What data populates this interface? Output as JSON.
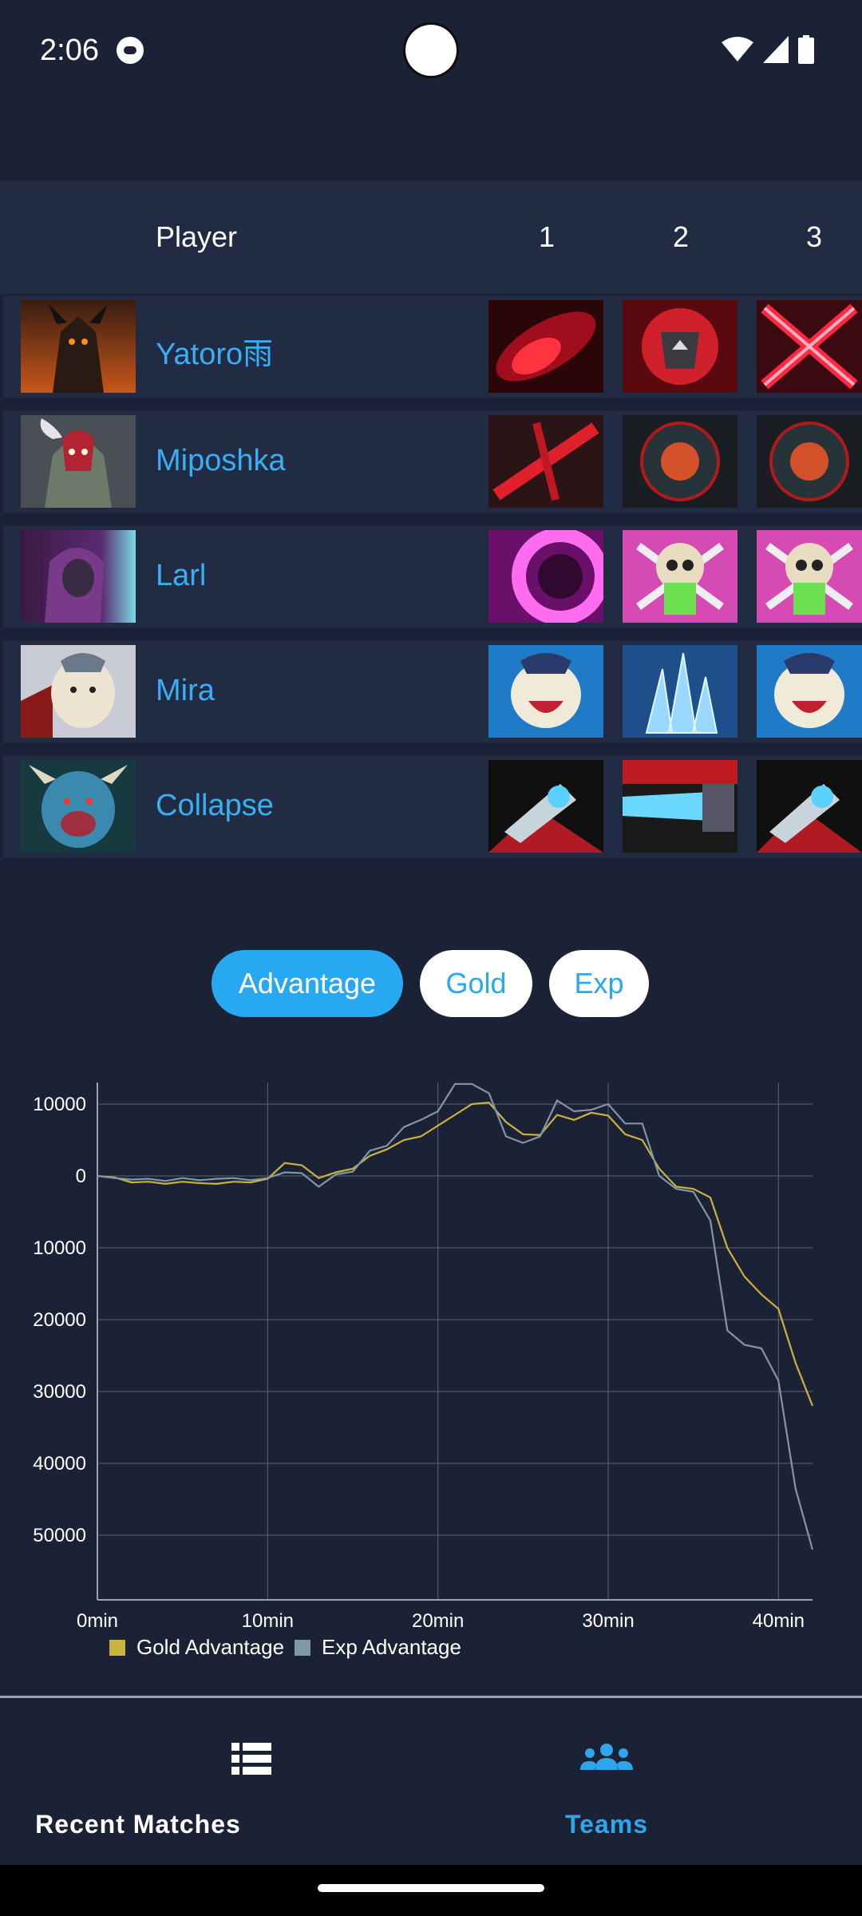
{
  "status": {
    "time": "2:06",
    "icons": [
      "app-notification-icon",
      "wifi-icon",
      "signal-icon",
      "battery-icon"
    ]
  },
  "table": {
    "headers": {
      "player": "Player",
      "col1": "1",
      "col2": "2",
      "col3": "3"
    },
    "rows": [
      {
        "name": "Yatoro雨",
        "avatar": "hero-avatar-doom",
        "items": [
          "red-slash-ability-icon",
          "red-rune-ability-icon",
          "red-x-slash-ability-icon"
        ]
      },
      {
        "name": "Miposhka",
        "avatar": "hero-avatar-shadow-demon",
        "items": [
          "red-x-slash-ability-icon",
          "blood-moon-ability-icon",
          "blood-moon-ability-icon"
        ]
      },
      {
        "name": "Larl",
        "avatar": "hero-avatar-void-spirit",
        "items": [
          "pink-swirl-ability-icon",
          "green-skull-ability-icon",
          "green-skull-ability-icon"
        ]
      },
      {
        "name": "Mira",
        "avatar": "hero-avatar-tusk",
        "items": [
          "tusk-roar-ability-icon",
          "ice-shards-ability-icon",
          "tusk-roar-ability-icon"
        ]
      },
      {
        "name": "Collapse",
        "avatar": "hero-avatar-spirit-breaker",
        "items": [
          "charge-ability-icon",
          "charge-dash-ability-icon",
          "charge-ability-icon"
        ]
      }
    ]
  },
  "tabs": {
    "advantage": "Advantage",
    "gold": "Gold",
    "exp": "Exp",
    "selected": "Advantage"
  },
  "chart_data": {
    "type": "line",
    "title": "",
    "xlabel": "",
    "ylabel": "",
    "x_ticks": [
      "0min",
      "10min",
      "20min",
      "30min",
      "40min"
    ],
    "y_ticks": [
      "10000",
      "0",
      "10000",
      "20000",
      "30000",
      "40000",
      "50000"
    ],
    "xlim": [
      0,
      42
    ],
    "ylim": [
      -59000,
      13000
    ],
    "grid": true,
    "legend_position": "bottom-left",
    "series": [
      {
        "name": "Gold Advantage",
        "color": "#c9b33f",
        "x": [
          0,
          1,
          2,
          3,
          4,
          5,
          6,
          7,
          8,
          9,
          10,
          11,
          12,
          13,
          14,
          15,
          16,
          17,
          18,
          19,
          20,
          21,
          22,
          23,
          24,
          25,
          26,
          27,
          28,
          29,
          30,
          31,
          32,
          33,
          34,
          35,
          36,
          37,
          38,
          39,
          40,
          41,
          42
        ],
        "y": [
          0,
          -200,
          -900,
          -800,
          -1100,
          -800,
          -1000,
          -1100,
          -800,
          -900,
          -400,
          1800,
          1500,
          -300,
          500,
          1000,
          2800,
          3700,
          5000,
          5500,
          7000,
          8500,
          10000,
          10200,
          7500,
          5800,
          5700,
          8500,
          7800,
          8800,
          8400,
          5800,
          5000,
          1000,
          -1500,
          -1800,
          -3000,
          -10000,
          -14000,
          -16500,
          -18500,
          -26000,
          -32000
        ]
      },
      {
        "name": "Exp Advantage",
        "color": "#7f97a6",
        "x": [
          0,
          1,
          2,
          3,
          4,
          5,
          6,
          7,
          8,
          9,
          10,
          11,
          12,
          13,
          14,
          15,
          16,
          17,
          18,
          19,
          20,
          21,
          22,
          23,
          24,
          25,
          26,
          27,
          28,
          29,
          30,
          31,
          32,
          33,
          34,
          35,
          36,
          37,
          38,
          39,
          40,
          41,
          42
        ],
        "y": [
          0,
          -300,
          -500,
          -400,
          -700,
          -300,
          -600,
          -400,
          -300,
          -600,
          -300,
          500,
          400,
          -1500,
          200,
          600,
          3500,
          4200,
          6800,
          7800,
          9000,
          12800,
          12800,
          11500,
          5500,
          4600,
          5500,
          10500,
          9000,
          9200,
          10000,
          7300,
          7300,
          0,
          -1800,
          -2200,
          -6200,
          -21500,
          -23500,
          -24000,
          -28500,
          -43500,
          -52000
        ]
      }
    ]
  },
  "nav": {
    "recent": {
      "label": "Recent Matches",
      "icon": "list-icon"
    },
    "teams": {
      "label": "Teams",
      "icon": "group-icon",
      "active": true
    }
  }
}
